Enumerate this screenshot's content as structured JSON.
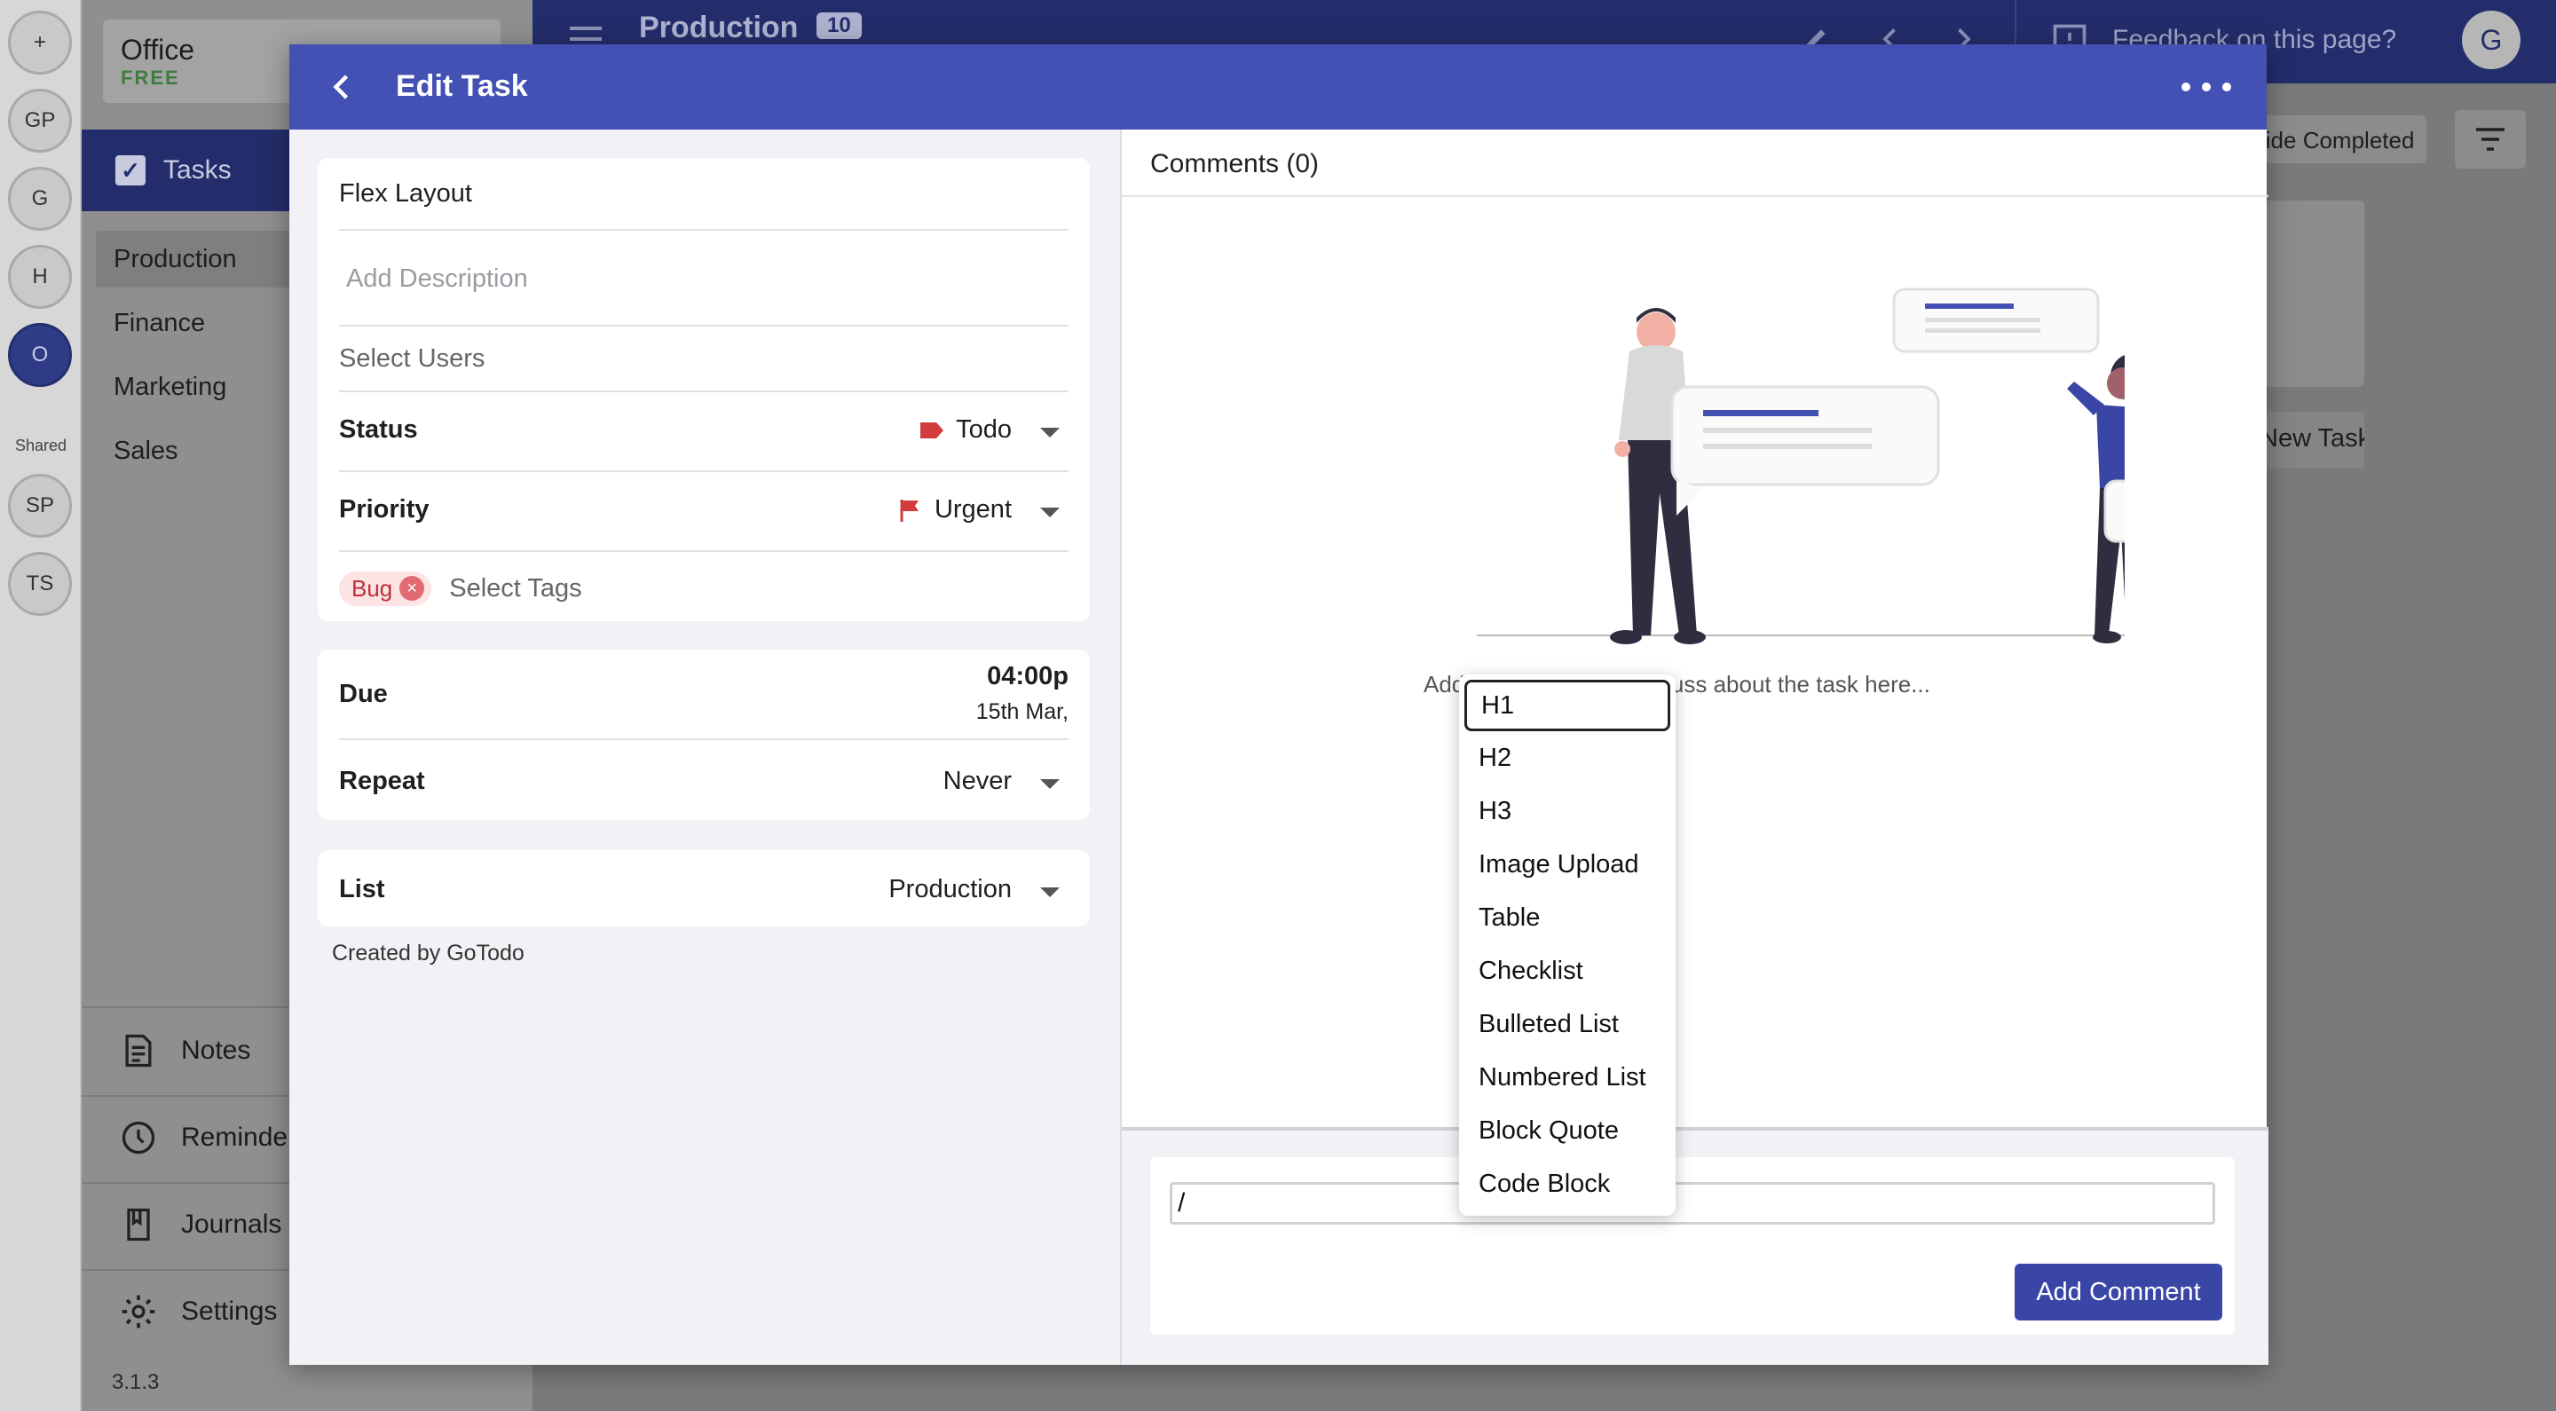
{
  "rail": {
    "add_label": "+",
    "workspaces": [
      "GP",
      "G",
      "H",
      "O"
    ],
    "shared_label": "Shared",
    "shared_workspaces": [
      "SP",
      "TS"
    ]
  },
  "sidebar": {
    "org_name": "Office",
    "org_plan": "FREE",
    "section_label": "Tasks",
    "lists": [
      "Production",
      "Finance",
      "Marketing",
      "Sales"
    ],
    "bottom": {
      "notes": "Notes",
      "reminders": "Reminders",
      "journals": "Journals",
      "settings": "Settings"
    },
    "version": "3.1.3"
  },
  "topbar": {
    "title": "Production",
    "count": "10",
    "feedback": "Feedback on this page?",
    "avatar": "G",
    "hide_completed": "Hide Completed",
    "new_task": "New Task"
  },
  "dialog": {
    "title": "Edit Task",
    "task_title": "Flex Layout",
    "description_placeholder": "Add Description",
    "users_placeholder": "Select Users",
    "status": {
      "label": "Status",
      "value": "Todo",
      "color": "#d23c3c"
    },
    "priority": {
      "label": "Priority",
      "value": "Urgent",
      "color": "#d23c3c"
    },
    "tags": {
      "chip": "Bug",
      "placeholder": "Select Tags"
    },
    "due": {
      "label": "Due",
      "time": "04:00p",
      "date": "15th Mar,"
    },
    "repeat": {
      "label": "Repeat",
      "value": "Never"
    },
    "list": {
      "label": "List",
      "value": "Production"
    },
    "created_by": "Created by GoTodo"
  },
  "comments": {
    "header": "Comments (0)",
    "empty_hint": "Add more details or discuss about the task here...",
    "input_value": "/",
    "submit_label": "Add Comment",
    "slash_menu": [
      "H1",
      "H2",
      "H3",
      "Image Upload",
      "Table",
      "Checklist",
      "Bulleted List",
      "Numbered List",
      "Block Quote",
      "Code Block"
    ]
  },
  "colors": {
    "primary": "#4350b4",
    "accent_button": "#3a46a6"
  }
}
